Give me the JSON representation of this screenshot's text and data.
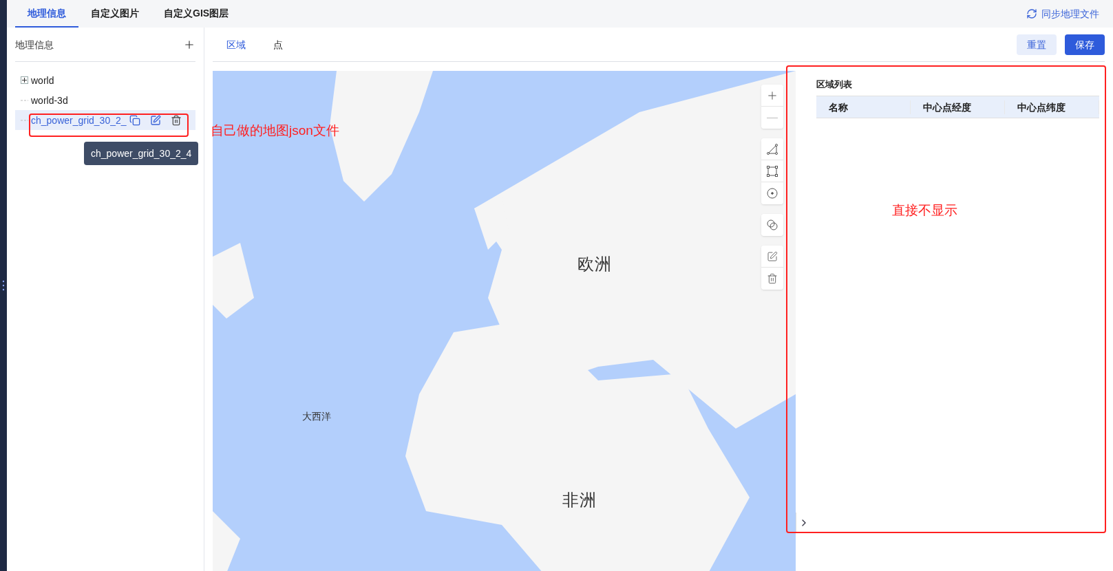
{
  "top_tabs": [
    {
      "label": "地理信息",
      "selected": true
    },
    {
      "label": "自定义图片",
      "selected": false
    },
    {
      "label": "自定义GIS图层",
      "selected": false
    }
  ],
  "sync_button": {
    "label": "同步地理文件"
  },
  "sidebar": {
    "title": "地理信息",
    "tree": [
      {
        "label": "world",
        "kind": "group",
        "expanded": false,
        "selected": false
      },
      {
        "label": "world-3d",
        "kind": "leaf",
        "selected": false
      },
      {
        "label": "ch_power_grid_30_2_",
        "kind": "leaf",
        "selected": true
      }
    ],
    "tooltip": "ch_power_grid_30_2_4"
  },
  "content_tabs": [
    {
      "label": "区域",
      "selected": true
    },
    {
      "label": "点",
      "selected": false
    }
  ],
  "buttons": [
    {
      "label": "重置",
      "kind": "secondary"
    },
    {
      "label": "保存",
      "kind": "primary"
    }
  ],
  "map": {
    "labels": [
      {
        "text": "欧洲",
        "kind": "large"
      },
      {
        "text": "大西洋",
        "kind": "small"
      },
      {
        "text": "非洲",
        "kind": "large"
      }
    ]
  },
  "region_panel": {
    "title": "区域列表",
    "columns": [
      "名称",
      "中心点经度",
      "中心点纬度"
    ]
  },
  "annotations": [
    {
      "text": "自己做的地图json文件"
    },
    {
      "text": "直接不显示"
    }
  ]
}
